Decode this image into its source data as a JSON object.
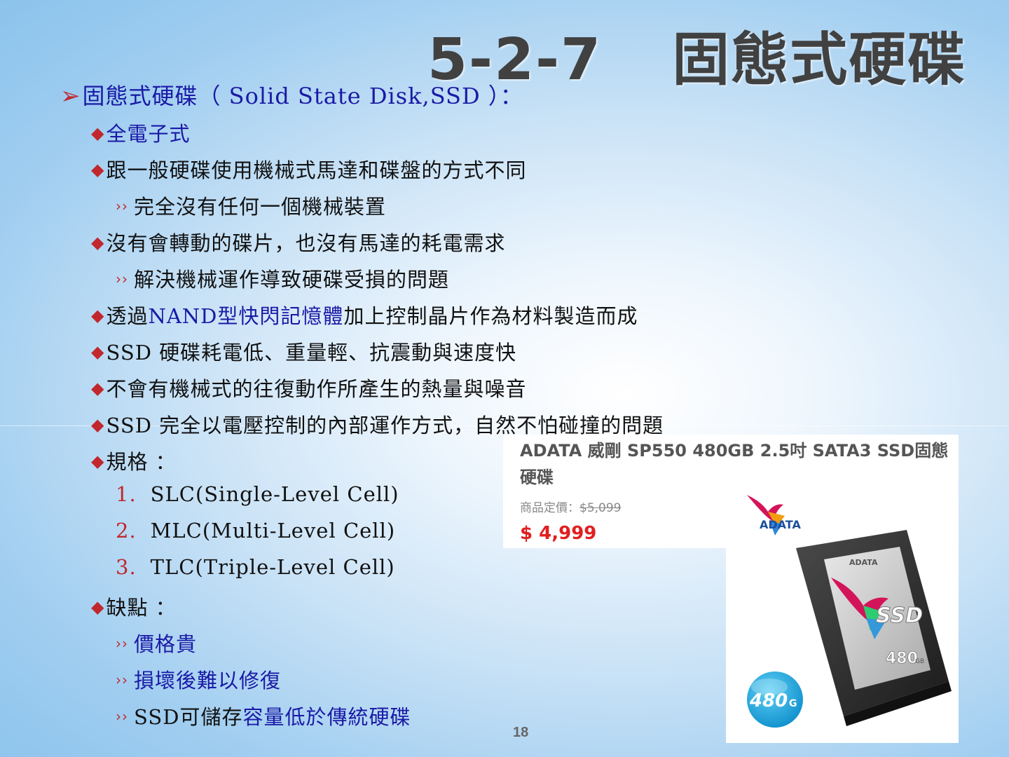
{
  "slide": {
    "title_number": "5-2-7",
    "title_text": "固態式硬碟",
    "page_number": "18"
  },
  "bullets": {
    "main": "固態式硬碟（ Solid State Disk,SSD ）：",
    "all_electronic": "全電子式",
    "diff_mech": "跟一般硬碟使用機械式馬達和碟盤的方式不同",
    "no_mech": "完全沒有任何一個機械裝置",
    "no_spin": "沒有會轉動的碟片，也沒有馬達的耗電需求",
    "solve": "解決機械運作導致硬碟受損的問題",
    "nand_prefix": "透過",
    "nand_blue": "NAND型快閃記憶體",
    "nand_suffix": "加上控制晶片作為材料製造而成",
    "low_power": "SSD 硬碟耗電低、重量輕、抗震動與速度快",
    "no_heat": "不會有機械式的往復動作所產生的熱量與噪音",
    "voltage": "SSD 完全以電壓控制的內部運作方式，自然不怕碰撞的問題",
    "spec": "規格 ：",
    "spec_items": [
      {
        "num": "1.",
        "text": "SLC(Single-Level Cell)"
      },
      {
        "num": "2.",
        "text": "MLC(Multi-Level Cell)"
      },
      {
        "num": "3.",
        "text": "TLC(Triple-Level Cell)"
      }
    ],
    "cons": "缺點 ：",
    "cons_price": "價格貴",
    "cons_repair": "損壞後難以修復",
    "cons_cap_prefix": "SSD可儲存",
    "cons_cap_blue": "容量低於傳統硬碟"
  },
  "product": {
    "title": "ADATA 威剛 SP550 480GB 2.5吋 SATA3 SSD固態硬碟",
    "list_label": "商品定價：",
    "list_price": "$5,099",
    "sale_price": "$ 4,999",
    "brand": "ADATA",
    "label_ssd": "SSD",
    "label_capacity": "480",
    "label_capacity_unit": "GB",
    "badge_capacity": "480",
    "badge_unit": "G"
  },
  "colors": {
    "bullet_red": "#c1272d",
    "emphasis_blue": "#1a1aa6",
    "price_red": "#e02020"
  }
}
